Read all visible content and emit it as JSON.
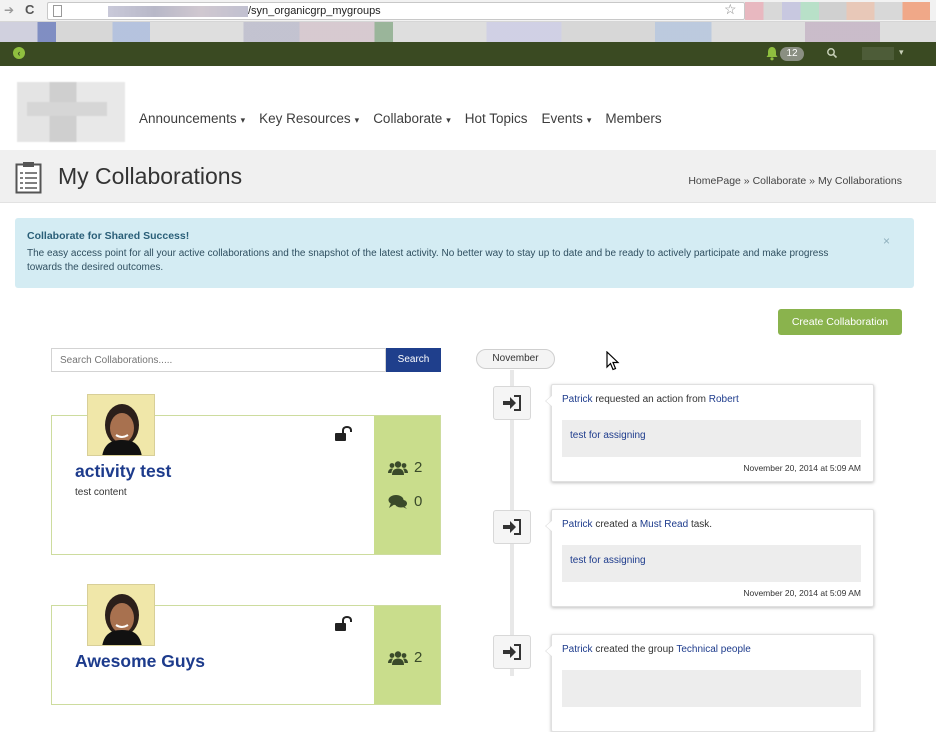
{
  "browser": {
    "url_suffix": "/syn_organicgrp_mygroups"
  },
  "topbar": {
    "notification_count": "12"
  },
  "nav": {
    "items": [
      {
        "label": "Announcements",
        "dropdown": true
      },
      {
        "label": "Key Resources",
        "dropdown": true
      },
      {
        "label": "Collaborate",
        "dropdown": true
      },
      {
        "label": "Hot Topics",
        "dropdown": false
      },
      {
        "label": "Events",
        "dropdown": true
      },
      {
        "label": "Members",
        "dropdown": false
      }
    ],
    "caret": "▾"
  },
  "page": {
    "title": "My Collaborations",
    "breadcrumb": [
      "HomePage",
      "Collaborate",
      "My Collaborations"
    ],
    "breadcrumb_sep": " » "
  },
  "alert": {
    "title": "Collaborate for Shared Success!",
    "body": "The easy access point for all your active collaborations and the snapshot of the latest activity. No better way to stay up to date and be ready to actively participate and make progress towards the desired outcomes.",
    "close": "×"
  },
  "actions": {
    "create_label": "Create Collaboration"
  },
  "search": {
    "placeholder": "Search Collaborations.....",
    "button_label": "Search"
  },
  "collaborations": [
    {
      "title": "activity test",
      "description": "test content",
      "members": "2",
      "comments": "0"
    },
    {
      "title": "Awesome Guys",
      "description": "",
      "members": "2",
      "comments": ""
    }
  ],
  "timeline": {
    "month": "November",
    "events": [
      {
        "actor": "Patrick",
        "text": " requested an action from ",
        "target": "Robert",
        "tail": "",
        "content": "test for assigning",
        "date": "November 20, 2014 at 5:09 AM"
      },
      {
        "actor": "Patrick",
        "text": " created a ",
        "target": "Must Read",
        "tail": " task.",
        "content": "test for assigning",
        "date": "November 20, 2014 at 5:09 AM"
      },
      {
        "actor": "Patrick",
        "text": " created the group ",
        "target": "Technical people",
        "tail": "",
        "content": "",
        "date": ""
      }
    ]
  },
  "colors": {
    "topbar": "#3a4a22",
    "accent_green": "#8ab34d",
    "card_side": "#c9dd8c",
    "link_blue": "#1d3b8c",
    "search_button": "#1f3f8c",
    "alert_bg": "#d4ecf3"
  }
}
